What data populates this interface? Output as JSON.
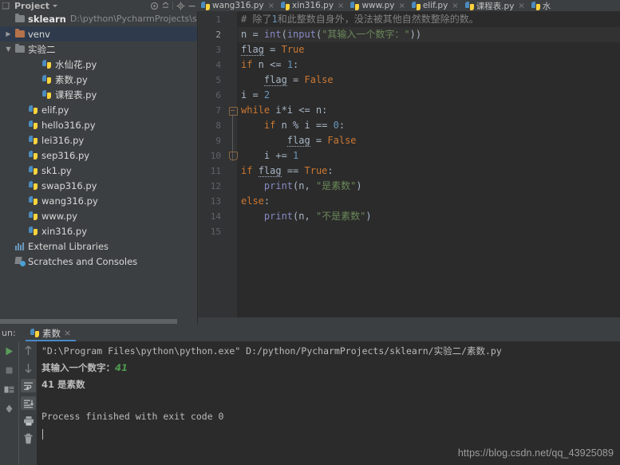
{
  "window": {
    "project_panel_title": "Project",
    "watermark": "https://blog.csdn.net/qq_43925089"
  },
  "project_toolbar": {
    "icons": [
      "locate-icon",
      "collapse-all-icon",
      "settings-gear-icon",
      "minimize-icon"
    ]
  },
  "editor_tabs": [
    {
      "label": "wang316.py",
      "icon": "python-file-icon",
      "close": "×"
    },
    {
      "label": "xin316.py",
      "icon": "python-file-icon",
      "close": "×"
    },
    {
      "label": "www.py",
      "icon": "python-file-icon",
      "close": "×"
    },
    {
      "label": "elif.py",
      "icon": "python-file-icon",
      "close": "×"
    },
    {
      "label": "课程表.py",
      "icon": "python-file-icon",
      "close": "×"
    },
    {
      "label": "水",
      "icon": "python-file-icon",
      "close": ""
    }
  ],
  "project_tree": [
    {
      "label": "sklearn",
      "path": "D:\\python\\PycharmProjects\\skle",
      "icon": "folder-icon",
      "indent": 0,
      "arrow": "",
      "bold": true,
      "selected": false
    },
    {
      "label": "venv",
      "path": "",
      "icon": "folder-orange-icon",
      "indent": 0,
      "arrow": "▶",
      "bold": false,
      "selected": true
    },
    {
      "label": "实验二",
      "path": "",
      "icon": "folder-icon",
      "indent": 0,
      "arrow": "▼",
      "bold": false,
      "selected": false
    },
    {
      "label": "水仙花.py",
      "path": "",
      "icon": "python-file-icon",
      "indent": 2,
      "arrow": "",
      "bold": false,
      "selected": false
    },
    {
      "label": "素数.py",
      "path": "",
      "icon": "python-file-icon",
      "indent": 2,
      "arrow": "",
      "bold": false,
      "selected": false
    },
    {
      "label": "课程表.py",
      "path": "",
      "icon": "python-file-icon",
      "indent": 2,
      "arrow": "",
      "bold": false,
      "selected": false
    },
    {
      "label": "elif.py",
      "path": "",
      "icon": "python-file-icon",
      "indent": 1,
      "arrow": "",
      "bold": false,
      "selected": false
    },
    {
      "label": "hello316.py",
      "path": "",
      "icon": "python-file-icon",
      "indent": 1,
      "arrow": "",
      "bold": false,
      "selected": false
    },
    {
      "label": "lei316.py",
      "path": "",
      "icon": "python-file-icon",
      "indent": 1,
      "arrow": "",
      "bold": false,
      "selected": false
    },
    {
      "label": "sep316.py",
      "path": "",
      "icon": "python-file-icon",
      "indent": 1,
      "arrow": "",
      "bold": false,
      "selected": false
    },
    {
      "label": "sk1.py",
      "path": "",
      "icon": "python-file-icon",
      "indent": 1,
      "arrow": "",
      "bold": false,
      "selected": false
    },
    {
      "label": "swap316.py",
      "path": "",
      "icon": "python-file-icon",
      "indent": 1,
      "arrow": "",
      "bold": false,
      "selected": false
    },
    {
      "label": "wang316.py",
      "path": "",
      "icon": "python-file-icon",
      "indent": 1,
      "arrow": "",
      "bold": false,
      "selected": false
    },
    {
      "label": "www.py",
      "path": "",
      "icon": "python-file-icon",
      "indent": 1,
      "arrow": "",
      "bold": false,
      "selected": false
    },
    {
      "label": "xin316.py",
      "path": "",
      "icon": "python-file-icon",
      "indent": 1,
      "arrow": "",
      "bold": false,
      "selected": false
    },
    {
      "label": "External Libraries",
      "path": "",
      "icon": "library-icon",
      "indent": 0,
      "arrow": "",
      "bold": false,
      "selected": false
    },
    {
      "label": "Scratches and Consoles",
      "path": "",
      "icon": "scratches-icon",
      "indent": 0,
      "arrow": "",
      "bold": false,
      "selected": false
    }
  ],
  "editor": {
    "line_numbers": [
      "1",
      "2",
      "3",
      "4",
      "5",
      "6",
      "7",
      "8",
      "9",
      "10",
      "11",
      "12",
      "13",
      "14",
      "15"
    ],
    "active_line": 2,
    "code_lines": [
      {
        "n": 1,
        "text": "# 除了1和此整数自身外，没法被其他自然数整除的数。"
      },
      {
        "n": 2,
        "text": "n = int(input(\"其输入一个数字：\"))"
      },
      {
        "n": 3,
        "text": "flag = True"
      },
      {
        "n": 4,
        "text": "if n <= 1:"
      },
      {
        "n": 5,
        "text": "    flag = False"
      },
      {
        "n": 6,
        "text": "i = 2"
      },
      {
        "n": 7,
        "text": "while i*i <= n:"
      },
      {
        "n": 8,
        "text": "    if n % i == 0:"
      },
      {
        "n": 9,
        "text": "        flag = False"
      },
      {
        "n": 10,
        "text": "    i += 1"
      },
      {
        "n": 11,
        "text": "if flag == True:"
      },
      {
        "n": 12,
        "text": "    print(n, \"是素数\")"
      },
      {
        "n": 13,
        "text": "else:"
      },
      {
        "n": 14,
        "text": "    print(n, \"不是素数\")"
      },
      {
        "n": 15,
        "text": ""
      }
    ]
  },
  "run_panel": {
    "label": "un:",
    "tab_label": "素数",
    "tab_close": "×",
    "sidebar_icons": [
      "run-icon",
      "stop-icon",
      "layout-icon",
      "pin-icon"
    ],
    "toolbar_icons": [
      "scroll-up-icon",
      "scroll-down-icon",
      "soft-wrap-icon",
      "scroll-to-end-icon",
      "print-icon",
      "trash-icon"
    ],
    "console_lines": [
      {
        "text": "\"D:\\Program Files\\python\\python.exe\" D:/python/PycharmProjects/sklearn/实验二/素数.py",
        "kind": "mono"
      },
      {
        "text": "其输入一个数字：",
        "input": "41",
        "kind": "cjk-with-input"
      },
      {
        "text": "41 是素数",
        "kind": "cjk"
      },
      {
        "text": "",
        "kind": "blank"
      },
      {
        "text": "Process finished with exit code 0",
        "kind": "mono"
      }
    ]
  },
  "colors": {
    "bg_chrome": "#3c3f41",
    "bg_editor": "#2b2b2b",
    "bg_gutter": "#313335",
    "selection": "#2f3b4c",
    "accent": "#4a88c7",
    "keyword": "#cc7832",
    "string": "#6a8759",
    "number": "#6897bb",
    "function": "#8888c6",
    "comment": "#808080",
    "text": "#a9b7c6",
    "input_echo": "#4e9a4e"
  }
}
